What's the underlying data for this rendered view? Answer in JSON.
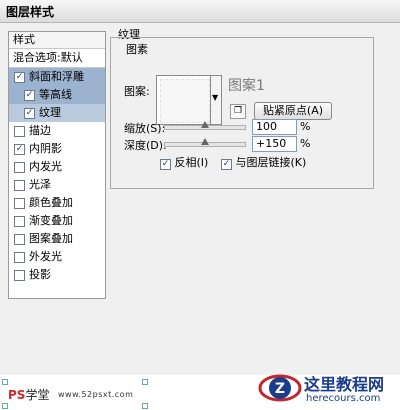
{
  "window": {
    "title": "图层样式"
  },
  "sidebar": {
    "header": "样式",
    "blend_item": "混合选项:默认",
    "items": [
      {
        "label": "斜面和浮雕",
        "checked": true,
        "state": "active",
        "indent": false
      },
      {
        "label": "等高线",
        "checked": true,
        "state": "active",
        "indent": true
      },
      {
        "label": "纹理",
        "checked": true,
        "state": "selected",
        "indent": true
      },
      {
        "label": "描边",
        "checked": false,
        "state": "",
        "indent": false
      },
      {
        "label": "内阴影",
        "checked": true,
        "state": "",
        "indent": false
      },
      {
        "label": "内发光",
        "checked": false,
        "state": "",
        "indent": false
      },
      {
        "label": "光泽",
        "checked": false,
        "state": "",
        "indent": false
      },
      {
        "label": "颜色叠加",
        "checked": false,
        "state": "",
        "indent": false
      },
      {
        "label": "渐变叠加",
        "checked": false,
        "state": "",
        "indent": false
      },
      {
        "label": "图案叠加",
        "checked": false,
        "state": "",
        "indent": false
      },
      {
        "label": "外发光",
        "checked": false,
        "state": "",
        "indent": false
      },
      {
        "label": "投影",
        "checked": false,
        "state": "",
        "indent": false
      }
    ]
  },
  "panel": {
    "section_title": "纹理",
    "group_title": "图素",
    "pattern_label": "图案:",
    "pattern_name": "图案1",
    "snap_button": "贴紧原点(A)",
    "scale": {
      "label": "缩放(S):",
      "value": "100",
      "unit": "%",
      "level": 0.5
    },
    "depth": {
      "label": "深度(D):",
      "value": "+150",
      "unit": "%",
      "level": 0.5
    },
    "invert": {
      "label": "反相(I)",
      "checked": true
    },
    "link": {
      "label": "与图层链接(K)",
      "checked": true
    }
  },
  "watermark": {
    "ps_brand_prefix": "PS",
    "ps_brand_suffix": "学堂",
    "ps_url": "www.52psxt.com",
    "site_title": "这里教程网",
    "site_url": "herecours.com"
  },
  "colors": {
    "active_bg": "#9bb3cf",
    "selected_bg": "#b9cade",
    "brand_blue": "#1a3c8a"
  }
}
